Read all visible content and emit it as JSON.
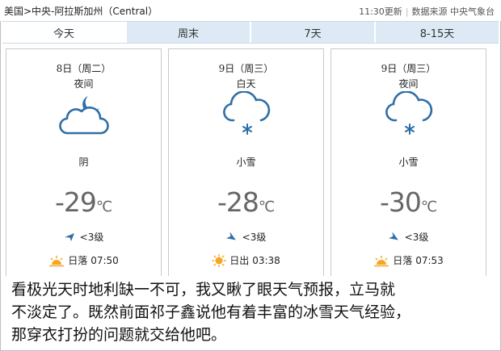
{
  "header": {
    "breadcrumb": "美国>中央-阿拉斯加州（Central）",
    "update_time": "11:30更新",
    "source": "数据来源 中央气象台"
  },
  "tabs": [
    {
      "label": "今天",
      "active": true
    },
    {
      "label": "周末",
      "active": false
    },
    {
      "label": "7天",
      "active": false
    },
    {
      "label": "8-15天",
      "active": false
    }
  ],
  "cards": [
    {
      "date": "8日（周二）",
      "period": "夜间",
      "icon": "cloud-moon-icon",
      "condition": "阴",
      "temp": "-29",
      "unit": "℃",
      "wind": "<3级",
      "sun_label": "日落",
      "sun_time": "07:50",
      "sun_icon": "sunset-icon"
    },
    {
      "date": "9日（周三）",
      "period": "白天",
      "icon": "cloud-snow-icon",
      "condition": "小雪",
      "temp": "-28",
      "unit": "℃",
      "wind": "<3级",
      "sun_label": "日出",
      "sun_time": "03:38",
      "sun_icon": "sunrise-icon"
    },
    {
      "date": "9日（周三）",
      "period": "夜间",
      "icon": "cloud-snow-icon",
      "condition": "小雪",
      "temp": "-30",
      "unit": "℃",
      "wind": "<3级",
      "sun_label": "日落",
      "sun_time": "07:53",
      "sun_icon": "sunset-icon"
    }
  ],
  "caption": {
    "line1": "看极光天时地利缺一不可，我又瞅了眼天气预报，立马就",
    "line2": "不淡定了。既然前面祁子鑫说他有着丰富的冰雪天气经验，",
    "line3": "那穿衣打扮的问题就交给他吧。"
  },
  "colors": {
    "icon_blue": "#2f6fa8",
    "tab_bg": "#ddeaf6",
    "sun_orange": "#f5a623"
  }
}
